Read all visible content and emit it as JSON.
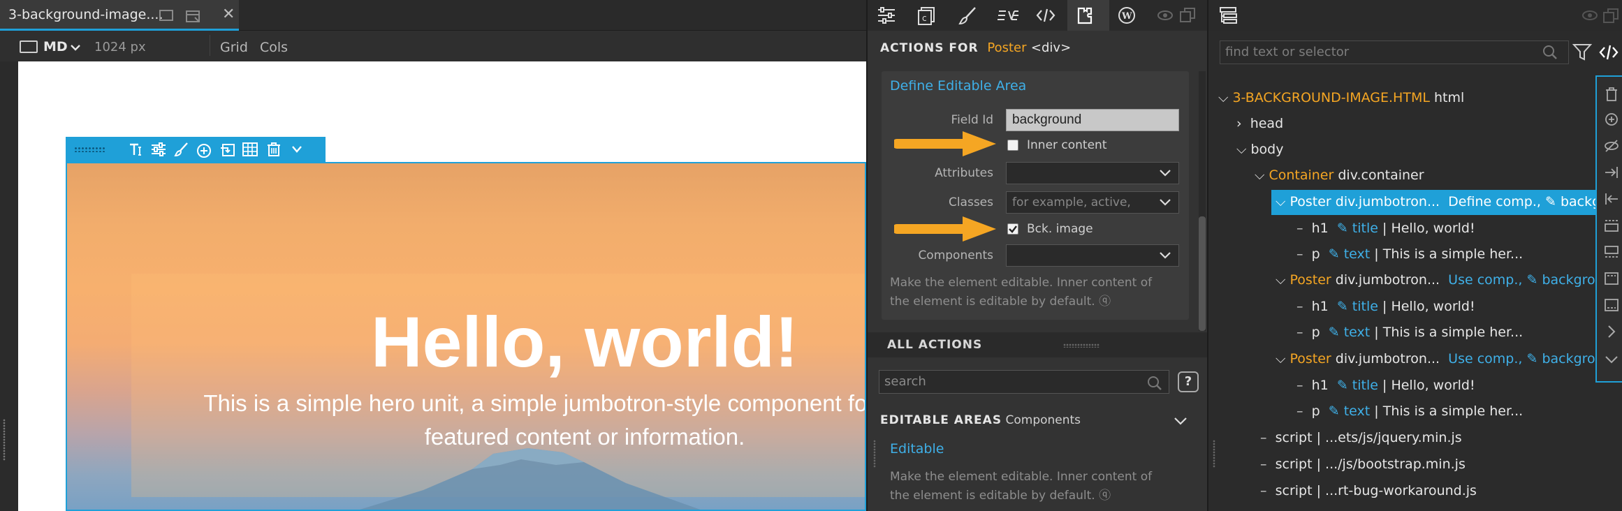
{
  "tab": {
    "title": "3-background-image....",
    "close": "✕"
  },
  "viewbar": {
    "device": "MD",
    "width": "1024 px",
    "grid": "Grid",
    "cols": "Cols"
  },
  "hero": {
    "heading": "Hello, world!",
    "paragraph_line1": "This is a simple hero unit, a simple jumbotron-style component for calling e",
    "paragraph_line2": "featured content or information."
  },
  "actions": {
    "header_prefix": "ACTIONS FOR",
    "element_name": "Poster",
    "element_tag": "<div>",
    "define_title": "Define Editable Area",
    "field_id_label": "Field Id",
    "field_id_value": "background",
    "inner_content_label": "Inner content",
    "inner_content_checked": false,
    "attributes_label": "Attributes",
    "attributes_value": "",
    "classes_label": "Classes",
    "classes_placeholder": "for example, active,",
    "bck_image_label": "Bck. image",
    "bck_image_checked": true,
    "components_label": "Components",
    "components_value": "",
    "help_line1": "Make the element editable. Inner content of",
    "help_line2": "the element is editable by default. ⓠ",
    "all_actions_label": "ALL ACTIONS",
    "search_placeholder": "search",
    "help_button": "?",
    "editable_areas_label": "EDITABLE AREAS",
    "editable_areas_sub": "Components",
    "editable_item": "Editable",
    "editable_desc_line1": "Make the element editable. Inner content of",
    "editable_desc_line2": "the element is editable by default. ⓠ"
  },
  "tree": {
    "find_placeholder": "find text or selector",
    "rows": [
      {
        "name": "3-BACKGROUND-IMAGE.HTML",
        "tag": "html"
      },
      {
        "tag": "head"
      },
      {
        "tag": "body"
      },
      {
        "name": "Container",
        "tag": "div.container"
      },
      {
        "name": "Poster",
        "tag": "div.jumbotron...",
        "action": "Define comp.,",
        "field": "backgro"
      },
      {
        "tag": "h1",
        "field": "title",
        "text": "| Hello, world!"
      },
      {
        "tag": "p",
        "field": "text",
        "text": "| This is a simple her..."
      },
      {
        "name": "Poster",
        "tag": "div.jumbotron...",
        "action": "Use comp.,",
        "field": "backgroun"
      },
      {
        "tag": "h1",
        "field": "title",
        "text": "| Hello, world!"
      },
      {
        "tag": "p",
        "field": "text",
        "text": "| This is a simple her..."
      },
      {
        "name": "Poster",
        "tag": "div.jumbotron...",
        "action": "Use comp.,",
        "field": "backgroun"
      },
      {
        "tag": "h1",
        "field": "title",
        "text": "| Hello, world!"
      },
      {
        "tag": "p",
        "field": "text",
        "text": "| This is a simple her..."
      },
      {
        "tag": "script",
        "text": "| ...ets/js/jquery.min.js"
      },
      {
        "tag": "script",
        "text": "| .../js/bootstrap.min.js"
      },
      {
        "tag": "script",
        "text": "| ...rt-bug-workaround.js"
      }
    ]
  },
  "colors": {
    "accent": "#1fa0d8",
    "orange": "#f5a623",
    "link": "#3fb0e8"
  }
}
